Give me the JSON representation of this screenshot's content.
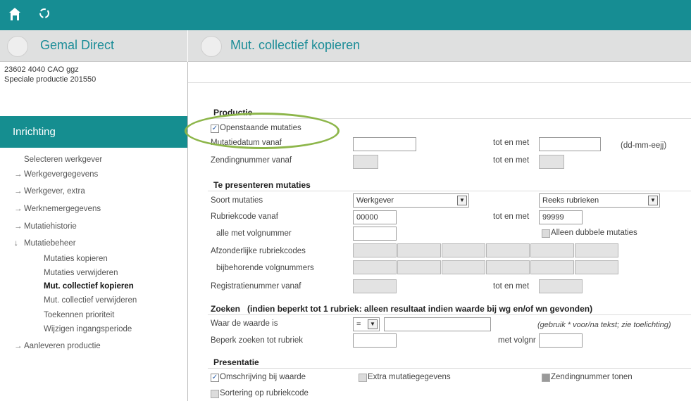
{
  "topbar": {
    "home_icon": "home-icon",
    "refresh_icon": "refresh-icon"
  },
  "sidebar": {
    "app_title": "Gemal Direct",
    "info_line1": "23602 4040 CAO ggz",
    "info_line2": "Speciale productie  201550",
    "section_title": "Inrichting",
    "items": [
      {
        "label": "Selecteren werkgever",
        "arrow": ""
      },
      {
        "label": "Werkgevergegevens",
        "arrow": "→"
      },
      {
        "label": "Werkgever, extra",
        "arrow": "→"
      },
      {
        "label": "Werknemergegevens",
        "arrow": "→"
      },
      {
        "label": "Mutatiehistorie",
        "arrow": "→"
      },
      {
        "label": "Mutatiebeheer",
        "arrow": "↓"
      },
      {
        "label": "Mutaties kopieren",
        "arrow": ""
      },
      {
        "label": "Mutaties verwijderen",
        "arrow": ""
      },
      {
        "label": "Mut. collectief kopieren",
        "arrow": ""
      },
      {
        "label": "Mut. collectief verwijderen",
        "arrow": ""
      },
      {
        "label": "Toekennen prioriteit",
        "arrow": ""
      },
      {
        "label": "Wijzigen ingangsperiode",
        "arrow": ""
      },
      {
        "label": "Aanleveren productie",
        "arrow": "→"
      }
    ]
  },
  "main": {
    "title": "Mut. collectief kopieren",
    "productie": {
      "heading": "Productie",
      "openstaande_label": "Openstaande mutaties",
      "openstaande_checked": "✓",
      "mutatiedatum_label": "Mutatiedatum vanaf",
      "tot_en_met": "tot en met",
      "date_hint": "(dd-mm-eejj)",
      "zendingnummer_label": "Zendingnummer vanaf"
    },
    "presenteren": {
      "heading": "Te presenteren mutaties",
      "soort_label": "Soort mutaties",
      "soort_value": "Werkgever",
      "reeks_value": "Reeks rubrieken",
      "rubriekcode_label": "Rubriekcode vanaf",
      "rubriek_from": "00000",
      "rubriek_to": "99999",
      "alle_label": "alle met volgnummer",
      "dubbele_label": "Alleen dubbele mutaties",
      "afzonderlijke_label": "Afzonderlijke rubriekcodes",
      "bijbehorende_label": "bijbehorende volgnummers",
      "registratie_label": "Registratienummer vanaf"
    },
    "zoeken": {
      "heading": "Zoeken",
      "subheading": "(indien beperkt tot 1 rubriek: alleen resultaat indien waarde bij wg en/of wn gevonden)",
      "waarde_label": "Waar de waarde is",
      "operator_value": "=",
      "hint": "(gebruik * voor/na tekst; zie toelichting)",
      "beperk_label": "Beperk zoeken tot rubriek",
      "met_volgnr": "met volgnr"
    },
    "presentatie": {
      "heading": "Presentatie",
      "omschrijving_label": "Omschrijving bij waarde",
      "omschrijving_checked": "✓",
      "extra_label": "Extra mutatiegegevens",
      "zending_tonen_label": "Zendingnummer tonen",
      "sortering_label": "Sortering op rubriekcode"
    }
  },
  "colors": {
    "teal": "#168d93",
    "highlight": "#8db64a"
  }
}
